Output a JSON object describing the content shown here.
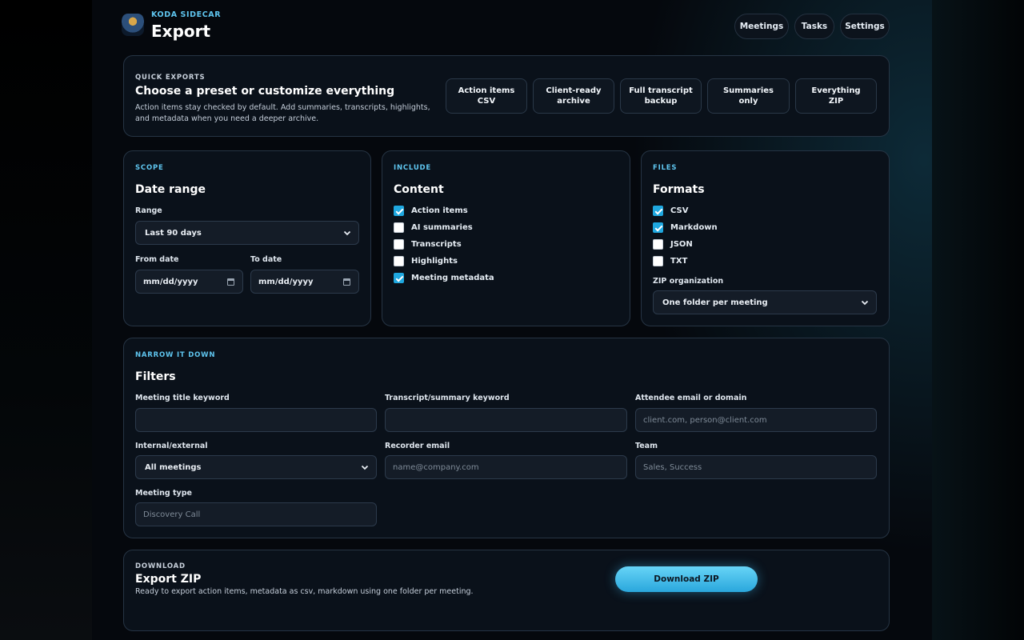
{
  "header": {
    "brand": "KODA SIDECAR",
    "title": "Export",
    "nav": [
      "Meetings",
      "Tasks",
      "Settings"
    ]
  },
  "quick_exports": {
    "eyebrow": "QUICK EXPORTS",
    "heading": "Choose a preset or customize everything",
    "description": "Action items stay checked by default. Add summaries, transcripts, highlights, and metadata when you need a deeper archive.",
    "presets": [
      "Action items CSV",
      "Client-ready archive",
      "Full transcript backup",
      "Summaries only",
      "Everything ZIP"
    ]
  },
  "scope": {
    "eyebrow": "SCOPE",
    "heading": "Date range",
    "range_label": "Range",
    "range_value": "Last 90 days",
    "from_label": "From date",
    "from_value": "mm/dd/yyyy",
    "to_label": "To date",
    "to_value": "mm/dd/yyyy"
  },
  "include": {
    "eyebrow": "INCLUDE",
    "heading": "Content",
    "items": [
      {
        "label": "Action items",
        "checked": true
      },
      {
        "label": "AI summaries",
        "checked": false
      },
      {
        "label": "Transcripts",
        "checked": false
      },
      {
        "label": "Highlights",
        "checked": false
      },
      {
        "label": "Meeting metadata",
        "checked": true
      }
    ]
  },
  "files": {
    "eyebrow": "FILES",
    "heading": "Formats",
    "formats": [
      {
        "label": "CSV",
        "checked": true
      },
      {
        "label": "Markdown",
        "checked": true
      },
      {
        "label": "JSON",
        "checked": false
      },
      {
        "label": "TXT",
        "checked": false
      }
    ],
    "zip_label": "ZIP organization",
    "zip_value": "One folder per meeting"
  },
  "filters": {
    "eyebrow": "NARROW IT DOWN",
    "heading": "Filters",
    "title_kw_label": "Meeting title keyword",
    "title_kw_placeholder": "",
    "transcript_kw_label": "Transcript/summary keyword",
    "transcript_kw_placeholder": "",
    "attendee_label": "Attendee email or domain",
    "attendee_placeholder": "client.com, person@client.com",
    "internal_label": "Internal/external",
    "internal_value": "All meetings",
    "recorder_label": "Recorder email",
    "recorder_placeholder": "name@company.com",
    "team_label": "Team",
    "team_placeholder": "Sales, Success",
    "type_label": "Meeting type",
    "type_placeholder": "Discovery Call"
  },
  "download": {
    "eyebrow": "DOWNLOAD",
    "heading": "Export ZIP",
    "description": "Ready to export action items, metadata as csv, markdown using one folder per meeting.",
    "button": "Download ZIP"
  },
  "colors": {
    "accent": "#5fc6f0",
    "checkbox": "#1fa8e0",
    "card_bg": "#0a111a"
  }
}
